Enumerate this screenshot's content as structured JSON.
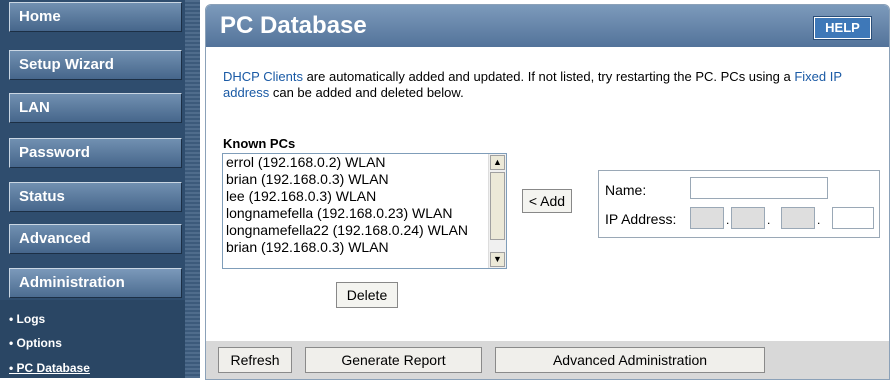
{
  "sidebar": {
    "items": [
      {
        "label": "Home"
      },
      {
        "label": "Setup Wizard"
      },
      {
        "label": "LAN"
      },
      {
        "label": "Password"
      },
      {
        "label": "Status"
      },
      {
        "label": "Advanced"
      },
      {
        "label": "Administration"
      }
    ],
    "sub_items": [
      {
        "label": "• Logs"
      },
      {
        "label": "• Options"
      },
      {
        "label": "• PC Database"
      }
    ]
  },
  "header": {
    "title": "PC Database",
    "help_label": "HELP"
  },
  "intro": {
    "link1": "DHCP Clients",
    "text1": " are automatically added and updated. If not listed, try restarting the PC. PCs using a ",
    "link2": "Fixed IP address",
    "text2": " can be added and deleted below."
  },
  "known": {
    "label": "Known PCs",
    "items": [
      "errol (192.168.0.2) WLAN",
      "brian (192.168.0.3) WLAN",
      "lee (192.168.0.3) WLAN",
      "longnamefella (192.168.0.23) WLAN",
      "longnamefella22 (192.168.0.24) WLAN",
      "brian (192.168.0.3) WLAN"
    ]
  },
  "buttons": {
    "add": "< Add",
    "delete": "Delete"
  },
  "entry": {
    "name_label": "Name:",
    "ip_label": "IP Address:",
    "name_value": "",
    "ip_octets": [
      "",
      "",
      "",
      ""
    ]
  },
  "footer": {
    "refresh": "Refresh",
    "report": "Generate Report",
    "advanced": "Advanced Administration"
  },
  "colors": {
    "header": "#5e7fa3",
    "sidebar": "#2f4d6e",
    "link": "#1a5aa5",
    "help": "#3e78b8"
  }
}
